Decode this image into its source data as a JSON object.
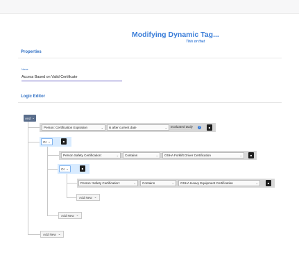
{
  "header": {
    "title": "Modifying Dynamic Tag...",
    "subtitle": "This or that"
  },
  "properties": {
    "section_title": "Properties",
    "name_label": "Name",
    "name_value": "Access Based on Valid Certificate"
  },
  "logic_editor": {
    "section_title": "Logic Editor",
    "root_operator": "And",
    "condition1": {
      "field": "Person: Certification Expiration",
      "operator": "is after current date",
      "note": "Evaluated Daily"
    },
    "group1": {
      "operator": "Or",
      "condition": {
        "field": "Person Safety Certification:",
        "operator": "Contains",
        "value": "OSHA Forklift Driver Certification"
      },
      "group2": {
        "operator": "Or",
        "condition": {
          "field": "Person: Safety Certification:",
          "operator": "Contains",
          "value": "OSHA Heavy Equipment Certification"
        },
        "add_new": "Add New"
      },
      "add_new": "Add New"
    },
    "add_new": "Add New"
  },
  "icons": {
    "dropdown": "chevron-down-icon",
    "delete": "trash-icon",
    "info": "info-icon"
  },
  "colors": {
    "accent": "#3a7dd8",
    "logic_button": "#5a6e8c",
    "group_highlight": "#d8ebff"
  }
}
